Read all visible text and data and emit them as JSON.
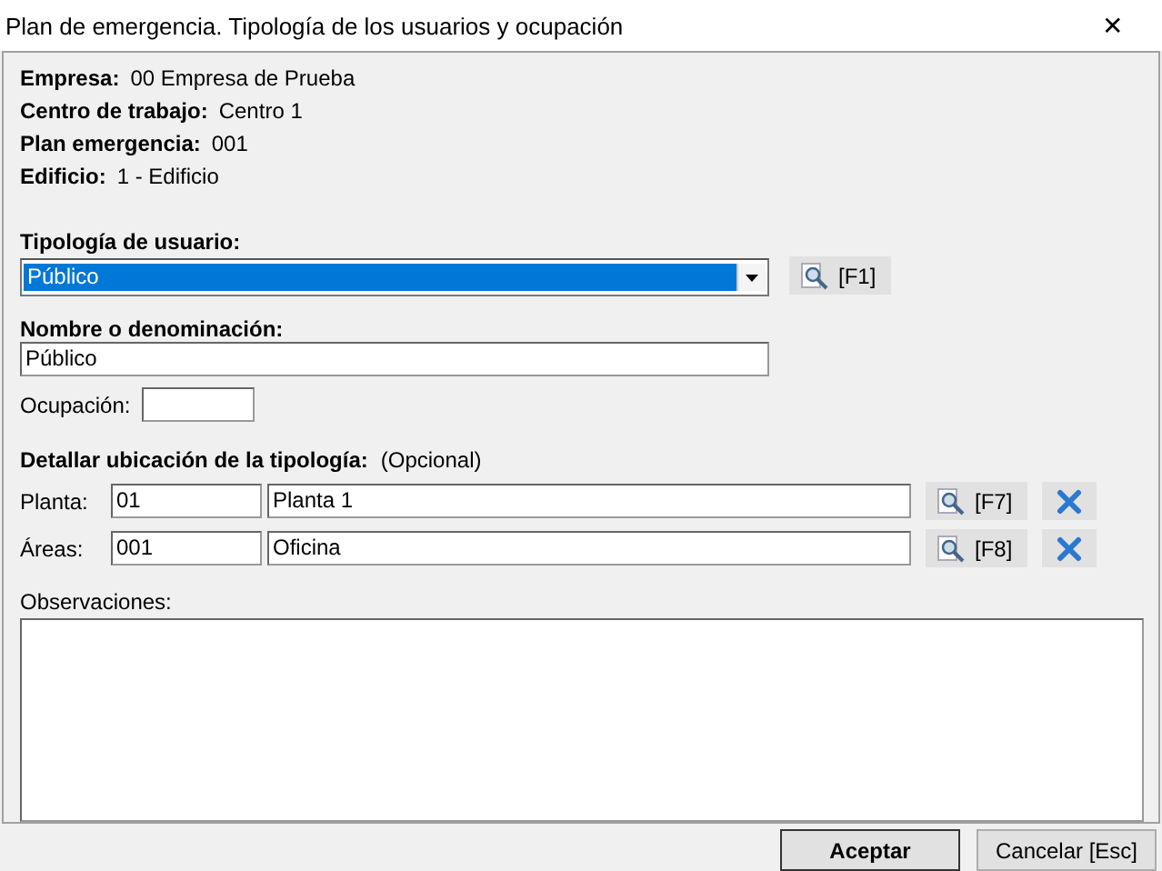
{
  "window": {
    "title": "Plan de emergencia. Tipología de los usuarios y ocupación",
    "close": "✕"
  },
  "info": [
    {
      "label": "Empresa:",
      "value": "00 Empresa de Prueba"
    },
    {
      "label": "Centro de trabajo:",
      "value": "Centro 1"
    },
    {
      "label": "Plan emergencia:",
      "value": "001"
    },
    {
      "label": "Edificio:",
      "value": "1 - Edificio"
    }
  ],
  "tipologia": {
    "label": "Tipología de usuario:",
    "value": "Público",
    "button": "[F1]"
  },
  "nombre": {
    "label": "Nombre o denominación:",
    "value": "Público"
  },
  "ocupacion": {
    "label": "Ocupación:"
  },
  "ubicacion": {
    "label": "Detallar ubicación de la tipología:",
    "note": "(Opcional)",
    "rows": [
      {
        "label": "Planta:",
        "code": "01",
        "name": "Planta 1",
        "button": "[F7]"
      },
      {
        "label": "Áreas:",
        "code": "001",
        "name": "Oficina",
        "button": "[F8]"
      }
    ]
  },
  "observaciones": {
    "label": "Observaciones:"
  },
  "buttons": [
    {
      "label": "Aceptar",
      "kind": "default"
    },
    {
      "label": "Cancelar [Esc]",
      "kind": "normal"
    }
  ]
}
